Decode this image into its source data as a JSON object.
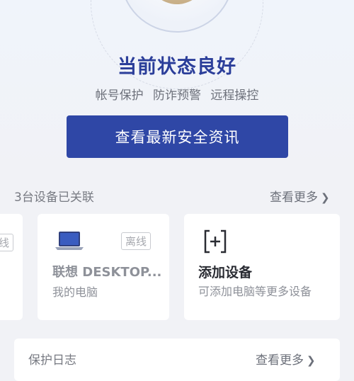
{
  "status": {
    "title": "当前状态良好",
    "features": [
      "帐号保护",
      "防诈预警",
      "远程操控"
    ]
  },
  "news_button": {
    "label": "查看最新安全资讯"
  },
  "devices": {
    "count_label": "3台设备已关联",
    "more_label": "查看更多",
    "partial_badge": "线",
    "items": [
      {
        "name": "联想 DESKTOP...",
        "sub": "我的电脑",
        "badge": "离线",
        "icon": "laptop-icon"
      }
    ],
    "add_card": {
      "title": "添加设备",
      "sub": "可添加电脑等更多设备",
      "icon": "add-device-icon"
    }
  },
  "protection_log": {
    "title": "保护日志",
    "more_label": "查看更多"
  },
  "colors": {
    "accent": "#2f47a6",
    "title": "#2b3e9a",
    "background": "#f1f2f6"
  }
}
